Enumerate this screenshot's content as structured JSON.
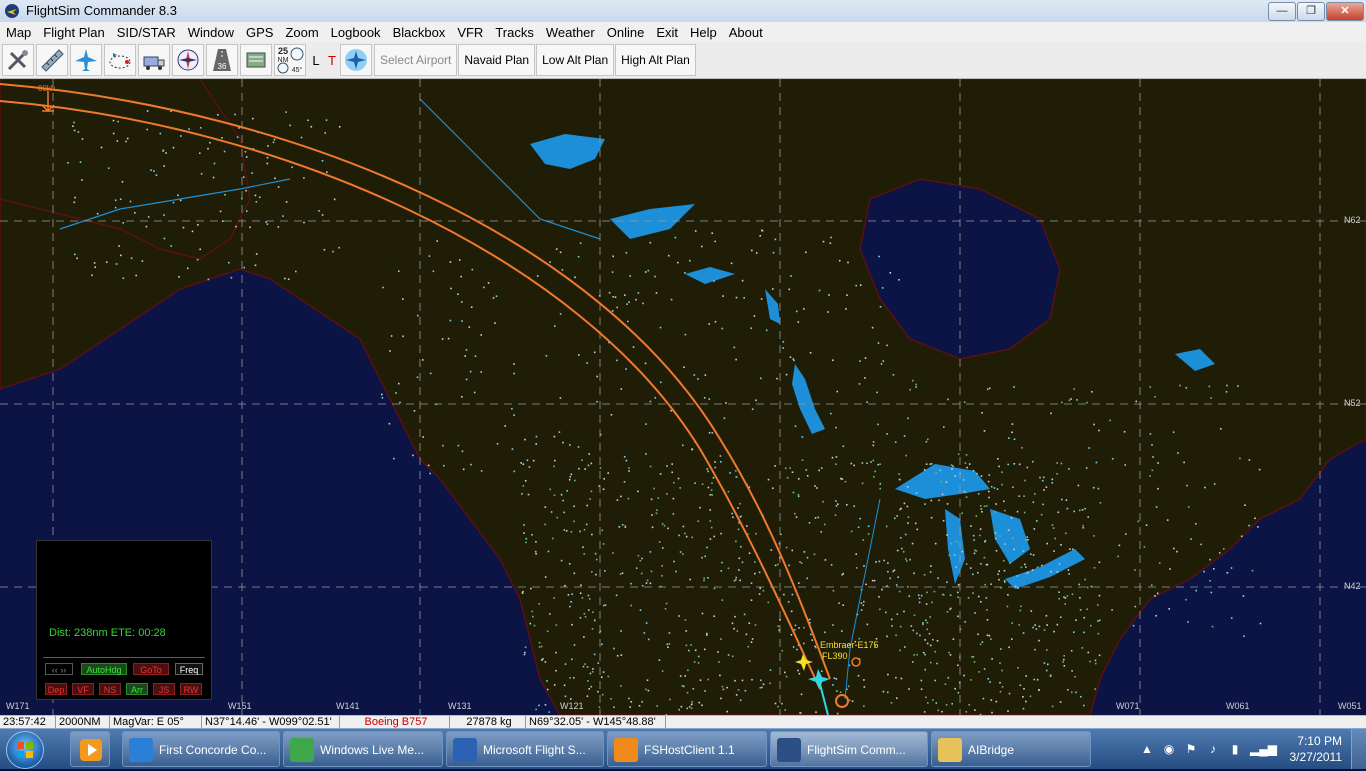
{
  "window": {
    "title": "FlightSim Commander 8.3",
    "minimize_glyph": "—",
    "maximize_glyph": "❐",
    "close_glyph": "✕"
  },
  "menu": [
    "Map",
    "Flight Plan",
    "SID/STAR",
    "Window",
    "GPS",
    "Zoom",
    "Logbook",
    "Blackbox",
    "VFR",
    "Tracks",
    "Weather",
    "Online",
    "Exit",
    "Help",
    "About"
  ],
  "toolbar": {
    "icons": [
      "tools-icon",
      "ruler-icon",
      "airplane-icon",
      "route-icon",
      "fuel-truck-icon",
      "compass-icon",
      "runway-icon",
      "scale-icon",
      "range-rings-icon"
    ],
    "runway_label": "36",
    "range_label": "25",
    "range_unit": "NM",
    "angle_label": "45°",
    "letter_l": "L",
    "letter_t": "T",
    "select_airport": "Select Airport",
    "navaid_plan": "Navaid Plan",
    "low_alt_plan": "Low Alt Plan",
    "high_alt_plan": "High Alt Plan"
  },
  "map": {
    "colors": {
      "ocean": "#0b1444",
      "land": "#201d07",
      "lake": "#1c8fd8",
      "route": "#f07a2b",
      "grid": "#9a9a9a"
    },
    "route_start_label": "00kh",
    "aircraft_label_1": "Embraer-E175",
    "aircraft_label_2": "FL390",
    "lat_labels": [
      "N62",
      "N52",
      "N42"
    ],
    "lon_labels": [
      "W171",
      "W151",
      "W141",
      "W131",
      "W121",
      "W071",
      "W061",
      "W051"
    ]
  },
  "info_panel": {
    "distance_text": "Dist: 238nm  ETE: 00:28",
    "autohdg": "AutoHdg",
    "goto": "GoTo",
    "freq": "Freq",
    "bottom_buttons": [
      "Dep",
      "VF",
      "NS",
      "Arr",
      "JS",
      "RW"
    ]
  },
  "status": {
    "time": "23:57:42",
    "range": "2000NM",
    "magvar": "MagVar: E 05°",
    "position": "N37°14.46' - W099°02.51'",
    "aircraft": "Boeing B757",
    "weight": "27878 kg",
    "cursor": "N69°32.05' - W145°48.88'"
  },
  "taskbar": {
    "tasks": [
      {
        "label": "First Concorde Co...",
        "icon_color": "#2a7fd6"
      },
      {
        "label": "Windows Live Me...",
        "icon_color": "#3fa84a"
      },
      {
        "label": "Microsoft Flight S...",
        "icon_color": "#2b62b3"
      },
      {
        "label": "FSHostClient 1.1",
        "icon_color": "#f08a1c"
      },
      {
        "label": "FlightSim Comm...",
        "icon_color": "#2c4f86"
      },
      {
        "label": "AIBridge",
        "icon_color": "#e6c25a"
      }
    ],
    "clock_time": "7:10 PM",
    "clock_date": "3/27/2011"
  }
}
